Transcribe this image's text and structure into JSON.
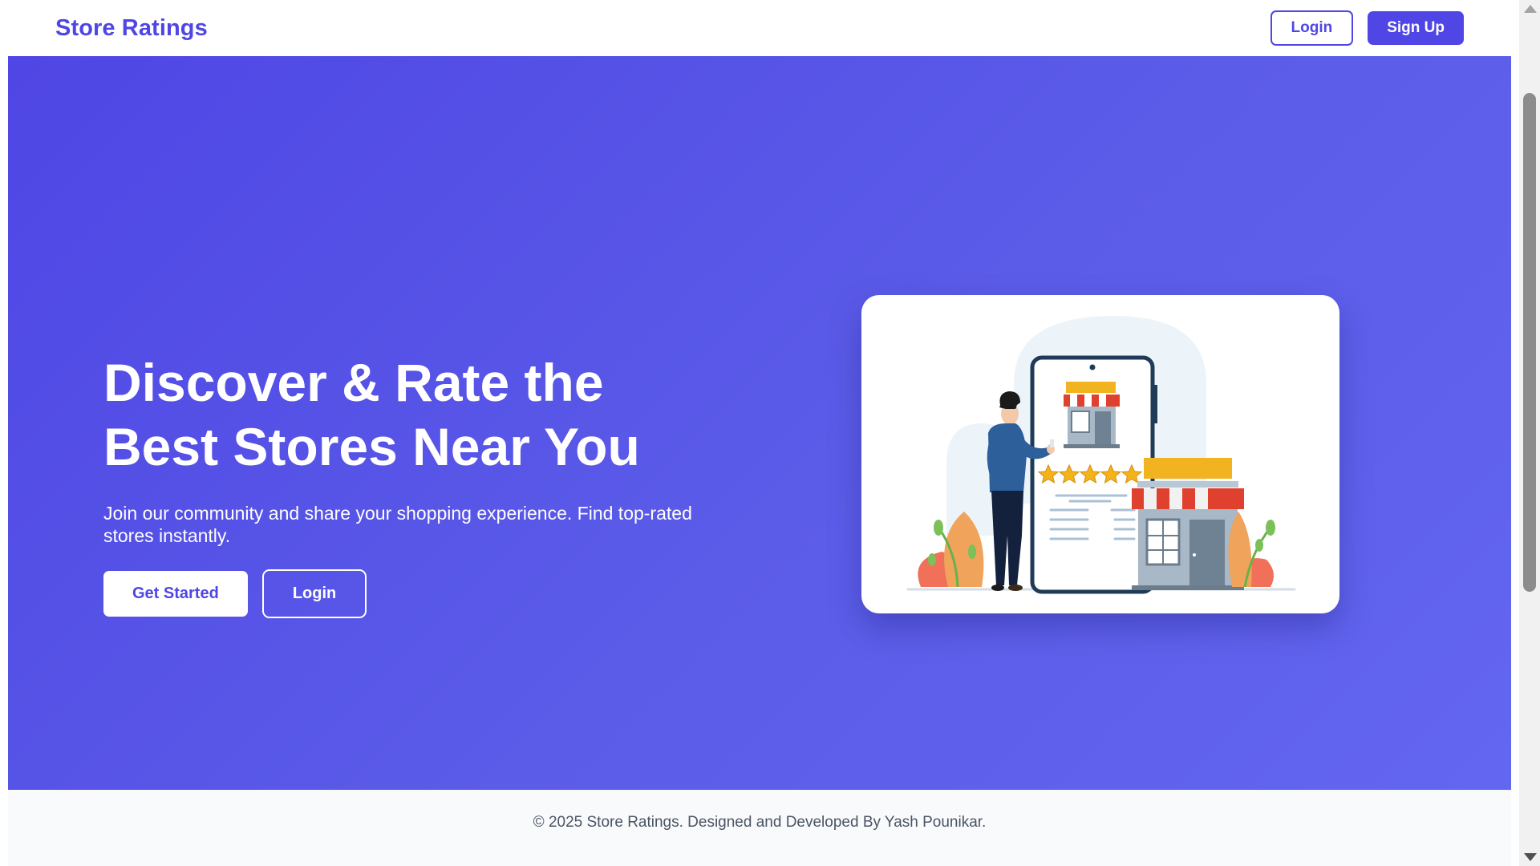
{
  "navbar": {
    "brand": "Store Ratings",
    "login_label": "Login",
    "signup_label": "Sign Up"
  },
  "hero": {
    "title": "Discover & Rate the Best Stores Near You",
    "subtitle": "Join our community and share your shopping experience. Find top-rated stores instantly.",
    "get_started_label": "Get Started",
    "login_label": "Login",
    "illustration": {
      "icon": "store-rating-illustration-icon",
      "stars": 5
    }
  },
  "footer": {
    "text": "© 2025 Store Ratings. Designed and Developed By Yash Pounikar."
  },
  "colors": {
    "brand": "#4f46e5",
    "hero_start": "#4f46e5",
    "hero_end": "#6366f1",
    "star": "#f5b31a",
    "awning_red": "#e0402e"
  }
}
